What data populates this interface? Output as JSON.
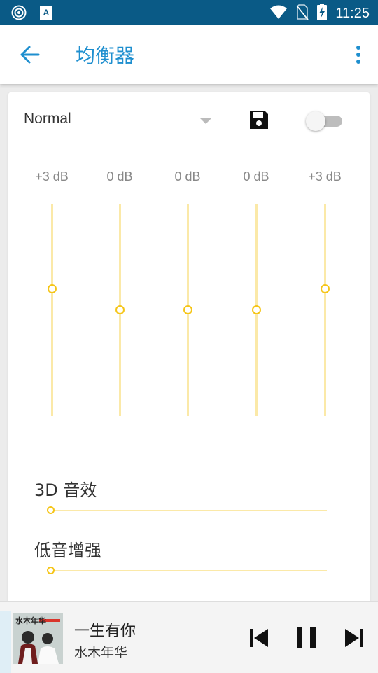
{
  "status_bar": {
    "time": "11:25"
  },
  "app_bar": {
    "title": "均衡器"
  },
  "equalizer": {
    "preset": "Normal",
    "enabled": false,
    "bands": [
      {
        "label": "+3 dB",
        "level": 0.6
      },
      {
        "label": "0 dB",
        "level": 0.5
      },
      {
        "label": "0 dB",
        "level": 0.5
      },
      {
        "label": "0 dB",
        "level": 0.5
      },
      {
        "label": "+3 dB",
        "level": 0.6
      }
    ],
    "effects": [
      {
        "label": "3D 音效",
        "level": 0
      },
      {
        "label": "低音增强",
        "level": 0
      }
    ]
  },
  "player": {
    "album_art_text": "水木年华",
    "song_title": "一生有你",
    "artist": "水木年华"
  },
  "colors": {
    "accent": "#1f8fcf",
    "status_bar": "#0a5a86",
    "slider_track": "#fbe9a8",
    "slider_thumb": "#f5c518"
  }
}
